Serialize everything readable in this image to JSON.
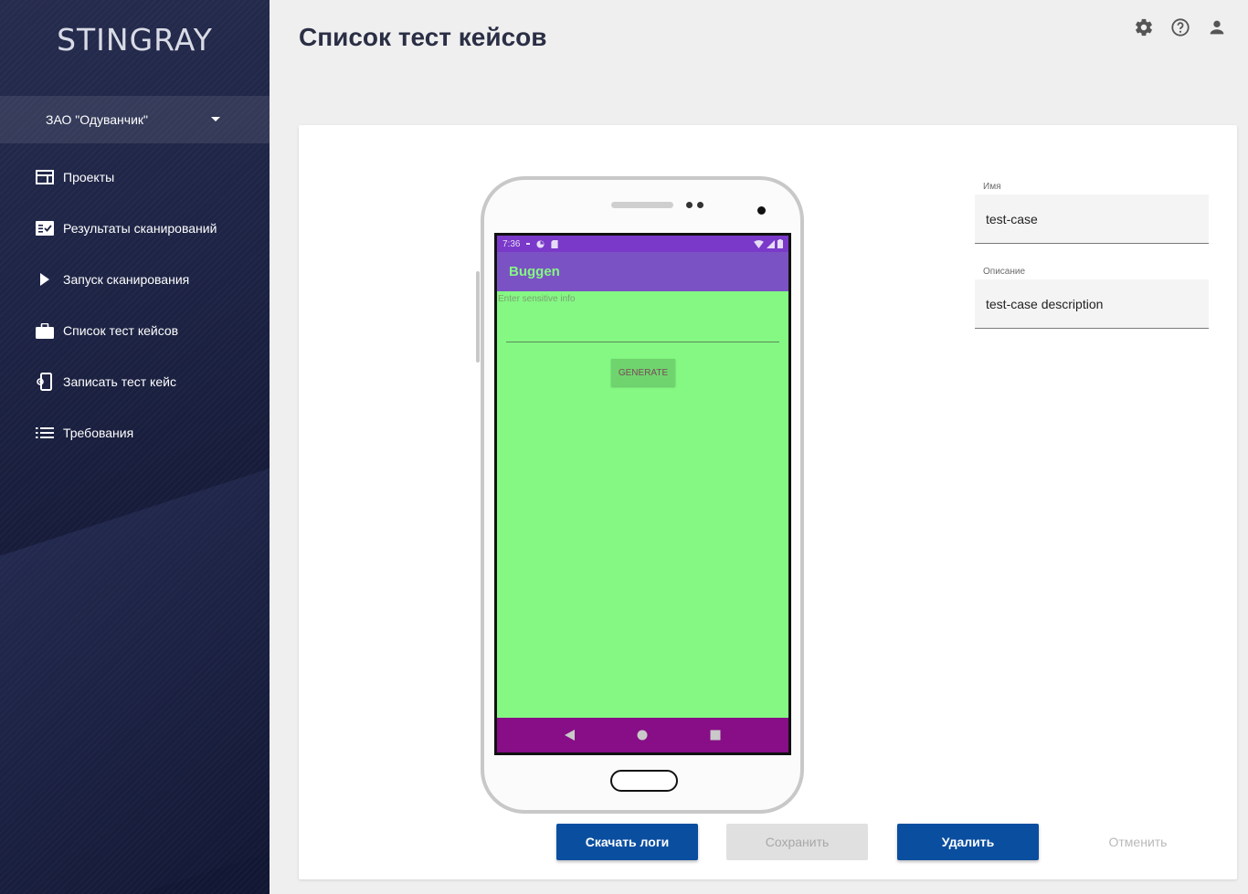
{
  "sidebar": {
    "logo": "STINGRAY",
    "org": "ЗАО \"Одуванчик\"",
    "items": [
      {
        "label": "Проекты",
        "icon": "projects-icon"
      },
      {
        "label": "Результаты сканирований",
        "icon": "scan-results-icon"
      },
      {
        "label": "Запуск сканирования",
        "icon": "play-icon"
      },
      {
        "label": "Список тест кейсов",
        "icon": "briefcase-icon"
      },
      {
        "label": "Записать тест кейс",
        "icon": "record-device-icon"
      },
      {
        "label": "Требования",
        "icon": "list-icon"
      }
    ]
  },
  "header": {
    "title": "Список тест кейсов",
    "icons": [
      "settings-icon",
      "help-icon",
      "account-icon"
    ]
  },
  "phone": {
    "status_time": "7:36",
    "app_title": "Buggen",
    "input_hint": "Enter sensitive info",
    "button_label": "GENERATE"
  },
  "form": {
    "name_label": "Имя",
    "name_value": "test-case",
    "description_label": "Описание",
    "description_value": "test-case description"
  },
  "actions": {
    "download_logs": "Скачать логи",
    "save": "Сохранить",
    "delete": "Удалить",
    "cancel": "Отменить"
  },
  "colors": {
    "sidebar_bg": "#1d2344",
    "primary": "#0a4ea0",
    "phone_screen": "#84f883",
    "app_bar": "#7b52c4",
    "status_bar": "#7a39c9",
    "nav_bar": "#870e86"
  }
}
